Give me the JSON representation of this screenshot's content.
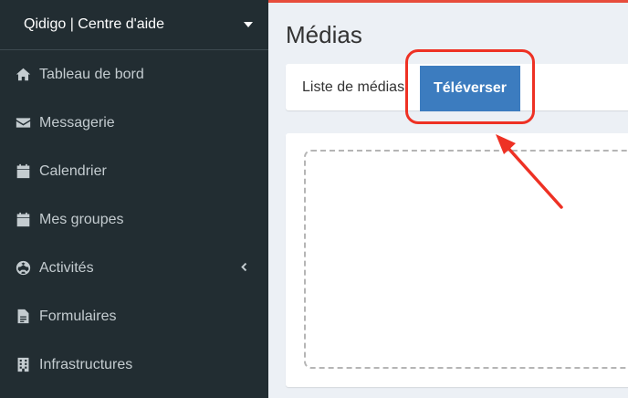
{
  "sidebar": {
    "brand": "Qidigo | Centre d'aide",
    "items": [
      {
        "label": "Tableau de bord",
        "icon": "home-icon"
      },
      {
        "label": "Messagerie",
        "icon": "envelope-icon"
      },
      {
        "label": "Calendrier",
        "icon": "calendar-icon"
      },
      {
        "label": "Mes groupes",
        "icon": "calendar-icon"
      },
      {
        "label": "Activités",
        "icon": "soccer-ball-icon"
      },
      {
        "label": "Formulaires",
        "icon": "document-icon"
      },
      {
        "label": "Infrastructures",
        "icon": "building-icon"
      }
    ]
  },
  "page": {
    "title": "Médias"
  },
  "tabs": {
    "list_label": "Liste de médias",
    "upload_label": "Téléverser",
    "active": "upload"
  },
  "colors": {
    "sidebar_bg": "#222d32",
    "accent_blue": "#3c7cbf",
    "highlight_red": "#ee3124"
  }
}
